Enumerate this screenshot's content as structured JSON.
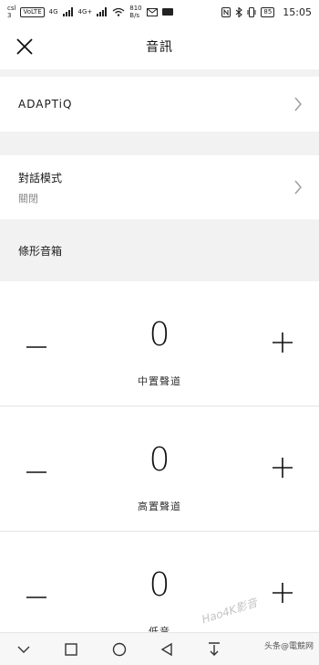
{
  "status_bar": {
    "carrier_top": "csl",
    "carrier_bottom": "3",
    "volte_badge": "VoLTE",
    "net_a": "4G",
    "net_b": "4G+",
    "speed_value": "810",
    "speed_unit": "B/s",
    "battery": "85",
    "time": "15:05"
  },
  "header": {
    "title": "音訊"
  },
  "rows": [
    {
      "label": "ADAPTiQ"
    },
    {
      "label": "對話模式",
      "value": "關閉"
    }
  ],
  "section": {
    "title": "條形音箱"
  },
  "controls": [
    {
      "value": "0",
      "label": "中置聲道"
    },
    {
      "value": "0",
      "label": "高置聲道"
    },
    {
      "value": "0",
      "label": "低音"
    }
  ],
  "watermark": "Hao4K影音",
  "brand": "头条@電競网",
  "colors": {
    "background": "#ffffff",
    "divider": "#f2f2f2",
    "subtext": "#8a8a8a"
  }
}
